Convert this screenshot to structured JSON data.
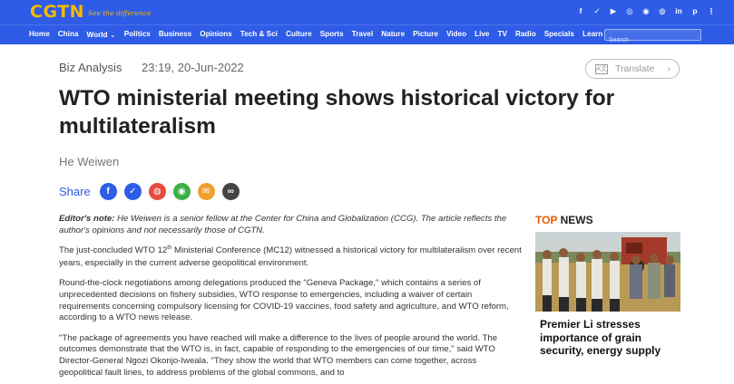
{
  "header": {
    "logo": "CGTN",
    "slogan": "See the difference",
    "socials": [
      "f",
      "t",
      "yt",
      "ig",
      "wechat",
      "weibo",
      "in",
      "p",
      "more"
    ]
  },
  "nav": {
    "items": [
      "Home",
      "China",
      "World",
      "Politics",
      "Business",
      "Opinions",
      "Tech & Sci",
      "Culture",
      "Sports",
      "Travel",
      "Nature",
      "Picture",
      "Video",
      "Live",
      "TV",
      "Radio",
      "Specials",
      "Learn Chinese"
    ],
    "search_placeholder": "Search"
  },
  "article": {
    "category": "Biz Analysis",
    "timestamp": "23:19, 20-Jun-2022",
    "translate_label": "Translate",
    "title": "WTO ministerial meeting shows historical victory for multilateralism",
    "author": "He Weiwen",
    "share_label": "Share",
    "editors_note_label": "Editor's note:",
    "editors_note": "He Weiwen is a senior fellow at the Center for China and Globalization (CCG). The article reflects the author's opinions and not necessarily those of CGTN.",
    "p1_a": "The just-concluded WTO 12",
    "p1_sup": "th",
    "p1_b": " Ministerial Conference (MC12) witnessed a historical victory for multilateralism over recent years, especially in the current adverse geopolitical environment.",
    "p2": "Round-the-clock negotiations among delegations produced the \"Geneva Package,\" which contains a series of unprecedented decisions on fishery subsidies, WTO response to emergencies, including a waiver of certain requirements concerning compulsory licensing for COVID-19 vaccines, food safety and agriculture, and WTO reform, according to a WTO news release.",
    "p3": "\"The package of agreements you have reached will make a difference to the lives of people around the world. The outcomes demonstrate that the WTO is, in fact, capable of responding to the emergencies of our time,\" said WTO Director-General Ngozi Okonjo-Iweala. \"They show the world that WTO members can come together, across geopolitical fault lines, to address problems of the global commons, and to"
  },
  "top_news": {
    "heading_accent": "TOP",
    "heading_rest": " NEWS",
    "headline": "Premier Li stresses importance of grain security, energy supply"
  },
  "colors": {
    "brand_blue": "#2e5ce6",
    "logo_gold": "#f5b800",
    "top_accent": "#e65c00"
  }
}
